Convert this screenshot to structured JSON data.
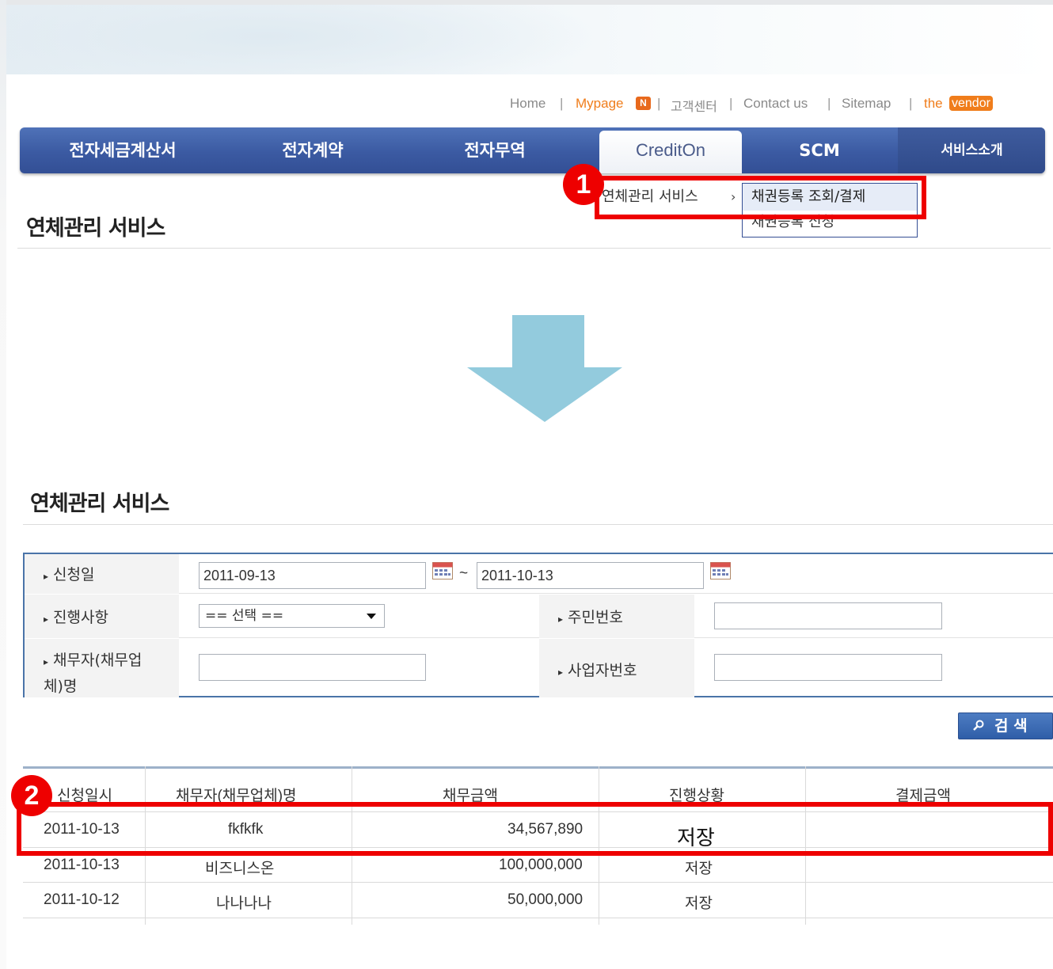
{
  "util_links": {
    "home": "Home",
    "sep": "|",
    "mypage": "Mypage",
    "mypage_badge": "N",
    "customer_center": "고객센터",
    "contact": "Contact us",
    "sitemap": "Sitemap",
    "the": "the",
    "vendor": "vendor"
  },
  "nav": {
    "items": [
      "전자세금계산서",
      "전자계약",
      "전자무역",
      "CreditOn",
      "SCM",
      "서비스소개"
    ],
    "active": "CreditOn"
  },
  "submenu": {
    "parent": "연체관리 서비스",
    "arrow": "›",
    "items": [
      "채권등록 조회/결제",
      "채권등록 신청"
    ]
  },
  "page_title": "연체관리 서비스",
  "search_form": {
    "date_label": "신청일",
    "date_from": "2011-09-13",
    "date_tilde": "~",
    "date_to": "2011-10-13",
    "status_label": "진행사항",
    "status_value": "== 선택 ==",
    "ssn_label": "주민번호",
    "debtor_label_line1": "채무자(채무업",
    "debtor_label_line2": "체)명",
    "bizno_label": "사업자번호",
    "search_button": "검 색"
  },
  "table": {
    "columns": [
      "신청일시",
      "채무자(채무업체)명",
      "채무금액",
      "진행상황",
      "결제금액"
    ],
    "rows": [
      {
        "date": "2011-10-13",
        "debtor": "fkfkfk",
        "amount": "34,567,890",
        "status": "저장",
        "paid": ""
      },
      {
        "date": "2011-10-13",
        "debtor": "비즈니스온",
        "amount": "100,000,000",
        "status": "저장",
        "paid": ""
      },
      {
        "date": "2011-10-12",
        "debtor": "나나나나",
        "amount": "50,000,000",
        "status": "저장",
        "paid": ""
      }
    ]
  },
  "annotations": {
    "step1": "1",
    "step2": "2",
    "highlight_color": "#ee0000",
    "arrow_color": "#93cbdd"
  },
  "colors": {
    "nav_blue": "#3b5aa2",
    "link_orange": "#f07d1b",
    "form_border": "#4a74a8"
  }
}
